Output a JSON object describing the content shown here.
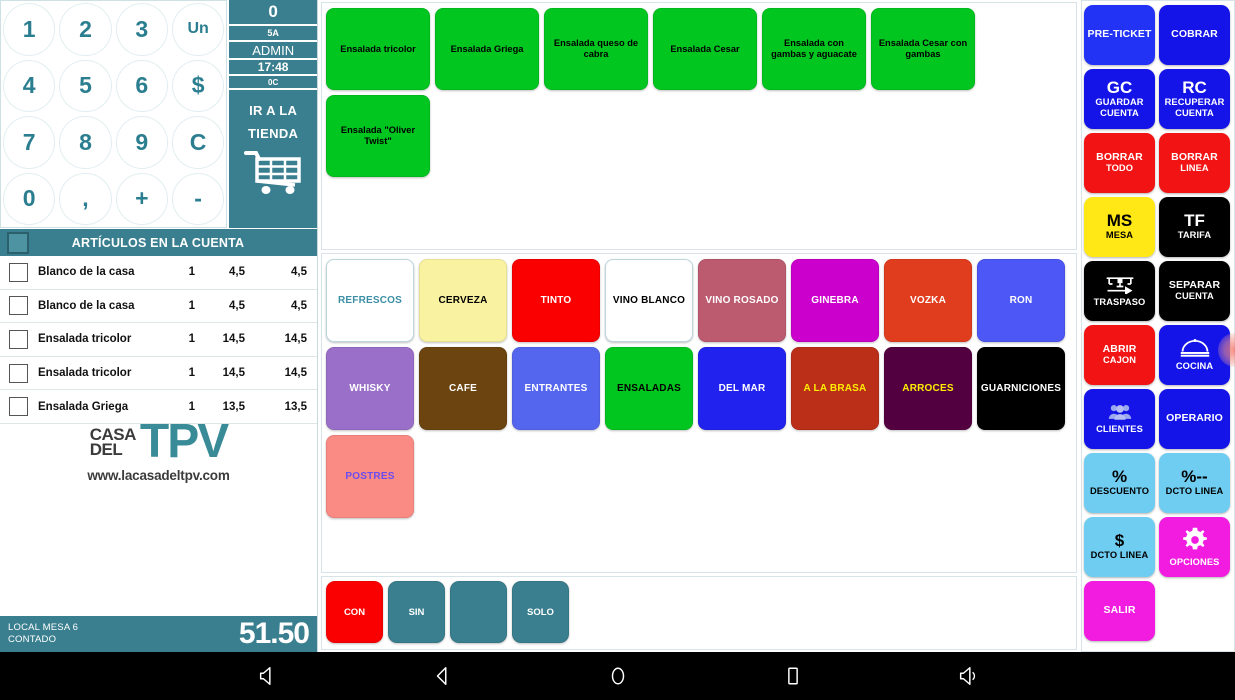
{
  "keypad": {
    "keys": [
      "1",
      "2",
      "3",
      "Un",
      "4",
      "5",
      "6",
      "$",
      "7",
      "8",
      "9",
      "C",
      "0",
      ",",
      "+",
      "-"
    ]
  },
  "status": {
    "count": "0",
    "terminal": "5A",
    "user": "ADMIN",
    "time": "17:48",
    "code": "0C",
    "store_line1": "IR A LA",
    "store_line2": "TIENDA",
    "cart_icon": "shopping-cart-icon"
  },
  "account": {
    "header": "ARTÍCULOS EN LA CUENTA",
    "items": [
      {
        "name": "Blanco de la casa",
        "qty": "1",
        "price": "4,5",
        "total": "4,5"
      },
      {
        "name": "Blanco de la casa",
        "qty": "1",
        "price": "4,5",
        "total": "4,5"
      },
      {
        "name": "Ensalada tricolor",
        "qty": "1",
        "price": "14,5",
        "total": "14,5"
      },
      {
        "name": "Ensalada tricolor",
        "qty": "1",
        "price": "14,5",
        "total": "14,5"
      },
      {
        "name": "Ensalada Griega",
        "qty": "1",
        "price": "13,5",
        "total": "13,5"
      }
    ],
    "watermark_casa": "CASA",
    "watermark_del": "DEL",
    "watermark_tpv": "TPV",
    "watermark_url": "www.lacasadeltpv.com",
    "footer_table": "LOCAL MESA 6",
    "footer_payment": "CONTADO",
    "footer_total": "51.50"
  },
  "products": [
    {
      "label": "Ensalada tricolor",
      "bg": "#00c61f",
      "fg": "#000000"
    },
    {
      "label": "Ensalada Griega",
      "bg": "#00c61f",
      "fg": "#000000"
    },
    {
      "label": "Ensalada queso de cabra",
      "bg": "#00c61f",
      "fg": "#000000"
    },
    {
      "label": "Ensalada Cesar",
      "bg": "#00c61f",
      "fg": "#000000"
    },
    {
      "label": "Ensalada con gambas y aguacate",
      "bg": "#00c61f",
      "fg": "#000000"
    },
    {
      "label": "Ensalada Cesar con gambas",
      "bg": "#00c61f",
      "fg": "#000000"
    },
    {
      "label": "Ensalada \"Oliver Twist\"",
      "bg": "#00c61f",
      "fg": "#000000"
    }
  ],
  "categories": [
    {
      "label": "REFRESCOS",
      "bg": "#ffffff",
      "fg": "#3b8fa4"
    },
    {
      "label": "CERVEZA",
      "bg": "#f9f2a0",
      "fg": "#000000"
    },
    {
      "label": "TINTO",
      "bg": "#fb0000",
      "fg": "#ffffff"
    },
    {
      "label": "VINO BLANCO",
      "bg": "#ffffff",
      "fg": "#000000"
    },
    {
      "label": "VINO ROSADO",
      "bg": "#bc5a70",
      "fg": "#ffffff"
    },
    {
      "label": "GINEBRA",
      "bg": "#cc00cc",
      "fg": "#ffffff"
    },
    {
      "label": "VOZKA",
      "bg": "#e03c1e",
      "fg": "#ffffff"
    },
    {
      "label": "RON",
      "bg": "#4d57f5",
      "fg": "#ffffff"
    },
    {
      "label": "WHISKY",
      "bg": "#9a6fc9",
      "fg": "#ffffff"
    },
    {
      "label": "CAFE",
      "bg": "#6b4410",
      "fg": "#ffffff"
    },
    {
      "label": "ENTRANTES",
      "bg": "#5566ee",
      "fg": "#ffffff"
    },
    {
      "label": "ENSALADAS",
      "bg": "#00c61f",
      "fg": "#000000"
    },
    {
      "label": "DEL MAR",
      "bg": "#2222ee",
      "fg": "#ffffff"
    },
    {
      "label": "A LA BRASA",
      "bg": "#bb2e18",
      "fg": "#ffee00"
    },
    {
      "label": "ARROCES",
      "bg": "#530040",
      "fg": "#ffee00"
    },
    {
      "label": "GUARNICIONES",
      "bg": "#000000",
      "fg": "#ffffff"
    },
    {
      "label": "POSTRES",
      "bg": "#f98a84",
      "fg": "#6a4df0"
    }
  ],
  "modifiers": [
    {
      "label": "CON",
      "bg": "#fb0000"
    },
    {
      "label": "SIN",
      "bg": "#3a7f8f"
    },
    {
      "label": "",
      "bg": "#3a7f8f"
    },
    {
      "label": "SOLO",
      "bg": "#3a7f8f"
    }
  ],
  "sidebar": [
    {
      "name": "pre-ticket",
      "top": "",
      "main": "PRE-TICKET",
      "sub": "",
      "bg": "#2233f5",
      "fg": "#ffffff",
      "icon": ""
    },
    {
      "name": "cobrar",
      "top": "",
      "main": "COBRAR",
      "sub": "",
      "bg": "#1414e8",
      "fg": "#ffffff",
      "icon": ""
    },
    {
      "name": "guardar-cuenta",
      "top": "GC",
      "main": "GUARDAR",
      "sub": "CUENTA",
      "bg": "#1414e8",
      "fg": "#ffffff",
      "icon": ""
    },
    {
      "name": "recuperar-cuenta",
      "top": "RC",
      "main": "RECUPERAR",
      "sub": "CUENTA",
      "bg": "#1414e8",
      "fg": "#ffffff",
      "icon": ""
    },
    {
      "name": "borrar-todo",
      "top": "",
      "main": "BORRAR",
      "sub": "TODO",
      "bg": "#f21414",
      "fg": "#ffffff",
      "icon": ""
    },
    {
      "name": "borrar-linea",
      "top": "",
      "main": "BORRAR",
      "sub": "LINEA",
      "bg": "#f21414",
      "fg": "#ffffff",
      "icon": ""
    },
    {
      "name": "mesa",
      "top": "MS",
      "main": "MESA",
      "sub": "",
      "bg": "#ffe815",
      "fg": "#000000",
      "icon": ""
    },
    {
      "name": "tarifa",
      "top": "TF",
      "main": "TARIFA",
      "sub": "",
      "bg": "#000000",
      "fg": "#ffffff",
      "icon": ""
    },
    {
      "name": "traspaso",
      "top": "",
      "main": "TRASPASO",
      "sub": "",
      "bg": "#000000",
      "fg": "#ffffff",
      "icon": "table-transfer-icon"
    },
    {
      "name": "separar-cuenta",
      "top": "",
      "main": "SEPARAR",
      "sub": "CUENTA",
      "bg": "#000000",
      "fg": "#ffffff",
      "icon": ""
    },
    {
      "name": "abrir-cajon",
      "top": "",
      "main": "ABRIR",
      "sub": "CAJON",
      "bg": "#f21414",
      "fg": "#ffffff",
      "icon": ""
    },
    {
      "name": "cocina",
      "top": "",
      "main": "COCINA",
      "sub": "",
      "bg": "#1414e8",
      "fg": "#ffffff",
      "icon": "cloche-icon"
    },
    {
      "name": "clientes",
      "top": "",
      "main": "CLIENTES",
      "sub": "",
      "bg": "#1414e8",
      "fg": "#ffffff",
      "icon": "people-icon"
    },
    {
      "name": "operario",
      "top": "",
      "main": "OPERARIO",
      "sub": "",
      "bg": "#1414e8",
      "fg": "#ffffff",
      "icon": ""
    },
    {
      "name": "descuento",
      "top": "%",
      "main": "DESCUENTO",
      "sub": "",
      "bg": "#6fcdf2",
      "fg": "#000000",
      "icon": ""
    },
    {
      "name": "dcto-linea-pct",
      "top": "%--",
      "main": "DCTO LINEA",
      "sub": "",
      "bg": "#6fcdf2",
      "fg": "#000000",
      "icon": ""
    },
    {
      "name": "dcto-linea-amt",
      "top": "$",
      "main": "DCTO LINEA",
      "sub": "",
      "bg": "#6fcdf2",
      "fg": "#000000",
      "icon": ""
    },
    {
      "name": "opciones",
      "top": "",
      "main": "OPCIONES",
      "sub": "",
      "bg": "#f21ce0",
      "fg": "#ffffff",
      "icon": "gear-icon"
    },
    {
      "name": "salir",
      "top": "",
      "main": "SALIR",
      "sub": "",
      "bg": "#f21ce0",
      "fg": "#ffffff",
      "icon": ""
    }
  ],
  "navbar": [
    {
      "name": "volume-down-icon"
    },
    {
      "name": "back-icon"
    },
    {
      "name": "home-icon"
    },
    {
      "name": "recents-icon"
    },
    {
      "name": "volume-up-icon"
    }
  ]
}
